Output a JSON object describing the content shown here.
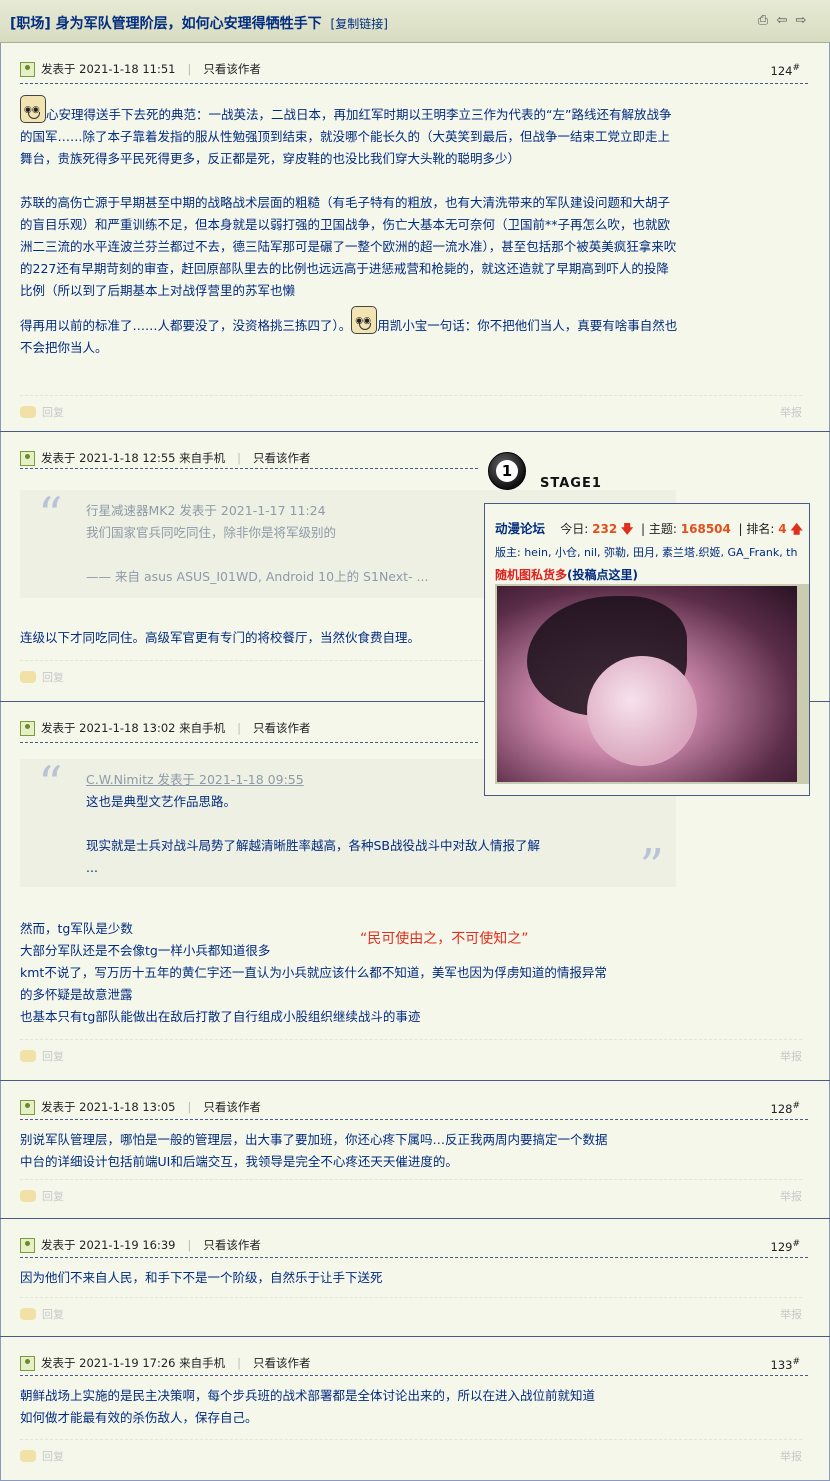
{
  "header": {
    "title": "[职场] 身为军队管理阶层，如何心安理得牺牲手下",
    "copy_link": "[复制链接]",
    "tools": [
      "print-icon",
      "prev-icon",
      "next-icon"
    ]
  },
  "common": {
    "reply": "回复",
    "report": "举报",
    "only_author": "只看该作者"
  },
  "posts": [
    {
      "meta": "发表于 2021-1-18 11:51",
      "floor": "124",
      "paragraphs": [
        "心安理得送手下去死的典范：一战英法，二战日本，再加红军时期以王明李立三作为代表的“左”路线还有解放战争的国军……除了本子靠着发指的服从性勉强顶到结束，就没哪个能长久的（大英笑到最后，但战争一结束工党立即走上舞台，贵族死得多平民死得更多，反正都是死，穿皮鞋的也没比我们穿大头靴的聪明多少）",
        "苏联的高伤亡源于早期甚至中期的战略战术层面的粗糙（有毛子特有的粗放，也有大清洗带来的军队建设问题和大胡子的盲目乐观）和严重训练不足，但本身就是以弱打强的卫国战争，伤亡大基本无可奈何（卫国前**子再怎么吹，也就欧洲二三流的水平连波兰芬兰都过不去，德三陆军那可是碾了一整个欧洲的超一流水准），甚至包括那个被英美疯狂拿来吹的227还有早期苛刻的审查，赶回原部队里去的比例也远远高于进惩戒营和枪毙的，就这还造就了早期高到吓人的投降比例（所以到了后期基本上对战俘营里的苏军也懒",
        "得再用以前的标准了……人都要没了，没资格挑三拣四了）。",
        "用凯小宝一句话：你不把他们当人，真要有啥事自然也不会把你当人。"
      ]
    },
    {
      "meta": "发表于 2021-1-18 12:55 来自手机",
      "quote_author": "行星减速器MK2 发表于 2021-1-17 11:24",
      "quote_lines": [
        "我们国家官兵同吃同住，除非你是将军级别的",
        "—— 来自 asus ASUS_I01WD, Android 10上的 S1Next- ..."
      ],
      "text": "连级以下才同吃同住。高级军官更有专门的将校餐厅，当然伙食费自理。"
    },
    {
      "meta": "发表于 2021-1-18 13:02 来自手机",
      "quote_author": "C.W.Nimitz",
      "quote_date": " 发表于 2021-1-18 09:55",
      "quote_lines": [
        "这也是典型文艺作品思路。",
        "现实就是士兵对战斗局势了解越清晰胜率越高，各种SB战役战斗中对敌人情报了解",
        "..."
      ],
      "lines": [
        "然而，tg军队是少数",
        "大部分军队还是不会像tg一样小兵都知道很多",
        "kmt不说了，写万历十五年的黄仁宇还一直认为小兵就应该什么都不知道，美军也因为俘虏知道的情报异常",
        "的多怀疑是故意泄露",
        "也基本只有tg部队能做出在敌后打散了自行组成小股组织继续战斗的事迹"
      ],
      "red_note": "“民可使由之，不可使知之”"
    },
    {
      "meta": "发表于 2021-1-18 13:05",
      "floor": "128",
      "lines": [
        "别说军队管理层，哪怕是一般的管理层，出大事了要加班，你还心疼下属吗…反正我两周内要搞定一个数据",
        "中台的详细设计包括前端UI和后端交互，我领导是完全不心疼还天天催进度的。"
      ]
    },
    {
      "meta": "发表于 2021-1-19 16:39",
      "floor": "129",
      "lines": [
        "因为他们不来自人民，和手下不是一个阶级，自然乐于让手下送死"
      ]
    },
    {
      "meta": "发表于 2021-1-19 17:26 来自手机",
      "floor": "133",
      "lines": [
        "朝鲜战场上实施的是民主决策啊，每个步兵班的战术部署都是全体讨论出来的，所以在进入战位前就知道",
        "如何做才能最有效的杀伤敌人，保存自己。"
      ]
    }
  ],
  "overlay": {
    "stage_number": "1",
    "stage_label": "STAGE1",
    "forum_name": "动漫论坛",
    "today_label": "今日:",
    "today_value": "232",
    "topics_label": "主题:",
    "topics_value": "168504",
    "rank_label": "排名:",
    "rank_value": "4",
    "moderators": "版主: hein, 小仓, nil, 弥勒, 田月, 素兰塔.织姬, GA_Frank, th",
    "random_pic_red": "随机图私货多",
    "random_pic_blue": "(投稿点这里)",
    "colors": {
      "accent_red": "#e0301d",
      "link_blue": "#022c80"
    }
  }
}
